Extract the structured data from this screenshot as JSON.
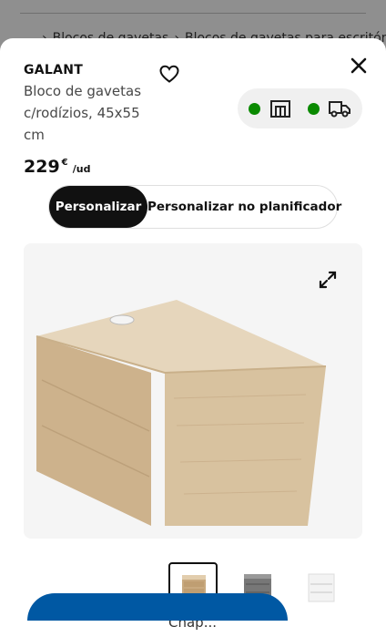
{
  "background": {
    "breadcrumb": [
      "Blocos de gavetas",
      "Blocos de gavetas para escritório"
    ]
  },
  "product": {
    "brand": "GALANT",
    "description": "Bloco de gavetas c/rodízios, 45x55 cm",
    "price": {
      "amount": "229",
      "currency": "€",
      "unit": "/ud"
    },
    "favorite_icon": "heart-icon",
    "close_icon": "close-icon"
  },
  "availability": {
    "store": {
      "status_color": "#0a8a00",
      "icon": "store-icon"
    },
    "delivery": {
      "status_color": "#0a8a00",
      "icon": "truck-icon"
    }
  },
  "customize": {
    "options": [
      "Personalizar",
      "Personalizar no planificador"
    ],
    "selected": "Personalizar"
  },
  "media": {
    "expand_icon": "expand-icon"
  },
  "variants": {
    "selected_label": "Chap...",
    "items": [
      "oak-veneer",
      "grey",
      "white"
    ]
  },
  "colors": {
    "accent": "#0058a3",
    "dark": "#111111",
    "available": "#0a8a00"
  }
}
